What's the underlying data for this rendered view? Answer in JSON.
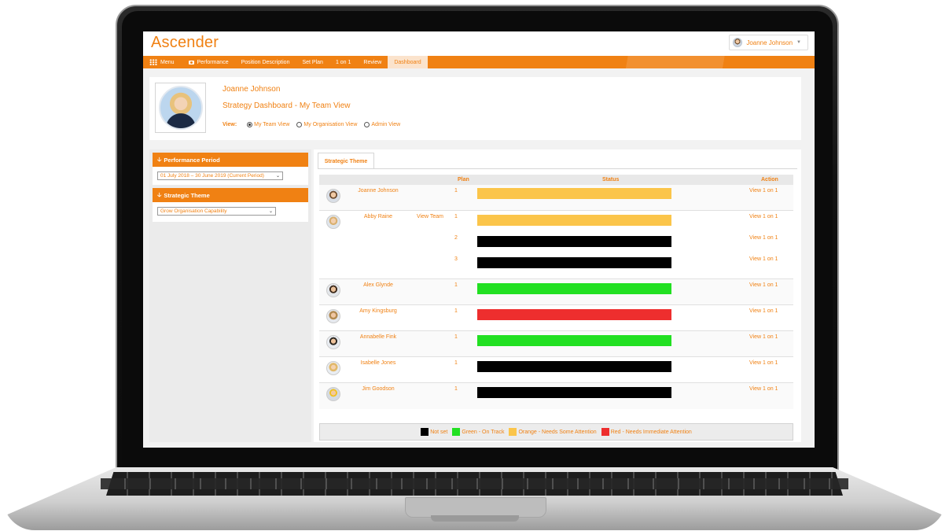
{
  "app": {
    "logo": "Ascender",
    "user_name": "Joanne Johnson"
  },
  "nav": {
    "menu": "Menu",
    "items": [
      "Performance",
      "Position Description",
      "Set Plan",
      "1 on 1",
      "Review",
      "Dashboard"
    ],
    "active": "Dashboard"
  },
  "profile": {
    "name": "Joanne Johnson",
    "title": "Strategy Dashboard - My Team View",
    "view_label": "View:",
    "views": [
      "My Team View",
      "My Organisation View",
      "Admin View"
    ],
    "selected_view": "My Team View"
  },
  "filters": {
    "period_header": "Performance Period",
    "period_value": "01 July 2018 – 30 June 2019 (Current Period)",
    "theme_header": "Strategic Theme",
    "theme_value": "Grow Organisation Capability"
  },
  "main": {
    "tab": "Strategic Theme",
    "columns": {
      "plan": "Plan",
      "status": "Status",
      "action": "Action"
    },
    "rows": [
      {
        "name": "Joanne Johnson",
        "team": "",
        "plans": [
          {
            "plan": "1",
            "status": "orange",
            "action": "View 1 on 1"
          }
        ]
      },
      {
        "name": "Abby Raine",
        "team": "View Team",
        "plans": [
          {
            "plan": "1",
            "status": "orange",
            "action": "View 1 on 1"
          },
          {
            "plan": "2",
            "status": "black",
            "action": "View 1 on 1"
          },
          {
            "plan": "3",
            "status": "black",
            "action": "View 1 on 1"
          }
        ]
      },
      {
        "name": "Alex Glynde",
        "team": "",
        "plans": [
          {
            "plan": "1",
            "status": "green",
            "action": "View 1 on 1"
          }
        ]
      },
      {
        "name": "Amy Kingsburg",
        "team": "",
        "plans": [
          {
            "plan": "1",
            "status": "red",
            "action": "View 1 on 1"
          }
        ]
      },
      {
        "name": "Annabelle Fink",
        "team": "",
        "plans": [
          {
            "plan": "1",
            "status": "green",
            "action": "View 1 on 1"
          }
        ]
      },
      {
        "name": "Isabelle Jones",
        "team": "",
        "plans": [
          {
            "plan": "1",
            "status": "black",
            "action": "View 1 on 1"
          }
        ]
      },
      {
        "name": "Jim Goodson",
        "team": "",
        "plans": [
          {
            "plan": "1",
            "status": "black",
            "action": "View 1 on 1"
          }
        ]
      }
    ],
    "legend": [
      {
        "label": "Not set",
        "color": "#000000"
      },
      {
        "label": "Green - On Track",
        "color": "#22e022"
      },
      {
        "label": "Orange - Needs Some Attention",
        "color": "#fbc54a"
      },
      {
        "label": "Red - Needs Immediate Attention",
        "color": "#ee2e2e"
      }
    ]
  },
  "colors": {
    "accent": "#f08113",
    "black": "#000000",
    "green": "#22e022",
    "orange": "#fbc54a",
    "red": "#ee2e2e"
  }
}
